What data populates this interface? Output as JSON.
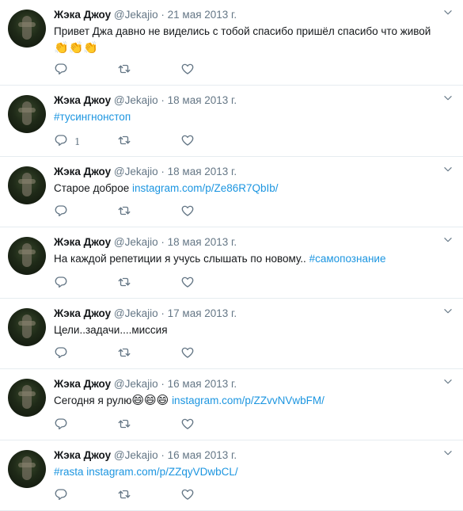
{
  "tweets": [
    {
      "name": "Жэка Джоу",
      "handle": "@Jekajio",
      "date": "21 мая 2013 г.",
      "segments": [
        {
          "type": "text",
          "value": "Привет Джа давно не виделись с тобой спасибо пришёл спасибо что живой"
        }
      ],
      "emoji_line": "👏👏👏",
      "reply_count": ""
    },
    {
      "name": "Жэка Джоу",
      "handle": "@Jekajio",
      "date": "18 мая 2013 г.",
      "segments": [
        {
          "type": "tag",
          "value": "#тусингнонстоп"
        }
      ],
      "reply_count": "1"
    },
    {
      "name": "Жэка Джоу",
      "handle": "@Jekajio",
      "date": "18 мая 2013 г.",
      "segments": [
        {
          "type": "text",
          "value": "Старое доброе "
        },
        {
          "type": "link",
          "value": "instagram.com/p/Ze86R7QbIb/"
        }
      ],
      "reply_count": ""
    },
    {
      "name": "Жэка Джоу",
      "handle": "@Jekajio",
      "date": "18 мая 2013 г.",
      "segments": [
        {
          "type": "text",
          "value": "На каждой репетиции я учусь слышать по новому.. "
        },
        {
          "type": "tag",
          "value": "#самопознание"
        }
      ],
      "reply_count": ""
    },
    {
      "name": "Жэка Джоу",
      "handle": "@Jekajio",
      "date": "17 мая 2013 г.",
      "segments": [
        {
          "type": "text",
          "value": "Цели..задачи....миссия"
        }
      ],
      "reply_count": ""
    },
    {
      "name": "Жэка Джоу",
      "handle": "@Jekajio",
      "date": "16 мая 2013 г.",
      "segments": [
        {
          "type": "text",
          "value": "Сегодня я рулю"
        },
        {
          "type": "emoji",
          "value": "😄😄😄"
        },
        {
          "type": "text",
          "value": " "
        },
        {
          "type": "link",
          "value": "instagram.com/p/ZZvvNVwbFM/"
        }
      ],
      "reply_count": ""
    },
    {
      "name": "Жэка Джоу",
      "handle": "@Jekajio",
      "date": "16 мая 2013 г.",
      "segments": [
        {
          "type": "tag",
          "value": "#rasta"
        },
        {
          "type": "text",
          "value": " "
        },
        {
          "type": "link",
          "value": "instagram.com/p/ZZqyVDwbCL/"
        }
      ],
      "reply_count": ""
    }
  ],
  "colors": {
    "link": "#1b95e0",
    "muted": "#657786",
    "text": "#14171a",
    "divider": "#e6ecf0"
  },
  "icons": {
    "menu": "chevron-down-icon",
    "reply": "reply-icon",
    "retweet": "retweet-icon",
    "like": "heart-icon"
  }
}
